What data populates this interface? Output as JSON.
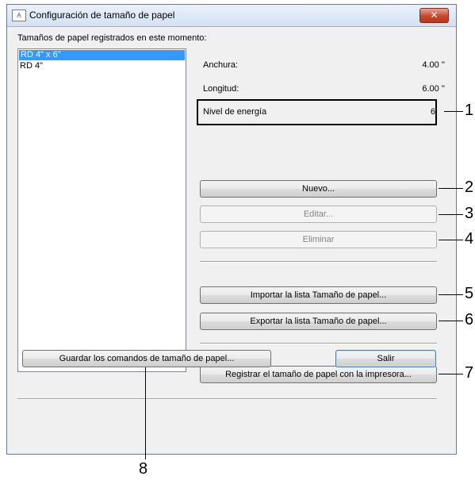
{
  "window": {
    "title": "Configuración de tamaño de papel",
    "close_glyph": "✕"
  },
  "list": {
    "label": "Tamaños de papel registrados en este momento:",
    "items": [
      "RD 4\" x 6\"",
      "RD 4\""
    ],
    "selected_index": 0
  },
  "properties": {
    "width_label": "Anchura:",
    "width_value": "4.00 ''",
    "length_label": "Longitud:",
    "length_value": "6.00 ''",
    "energy_label": "Nivel de energía",
    "energy_value": "6"
  },
  "buttons": {
    "new": "Nuevo...",
    "edit": "Editar...",
    "delete": "Eliminar",
    "import": "Importar la lista Tamaño de papel...",
    "export": "Exportar la lista Tamaño de papel...",
    "register": "Registrar el tamaño de papel con la impresora...",
    "save_commands": "Guardar los comandos de tamaño de papel...",
    "exit": "Salir"
  },
  "callouts": [
    "1",
    "2",
    "3",
    "4",
    "5",
    "6",
    "7",
    "8"
  ]
}
